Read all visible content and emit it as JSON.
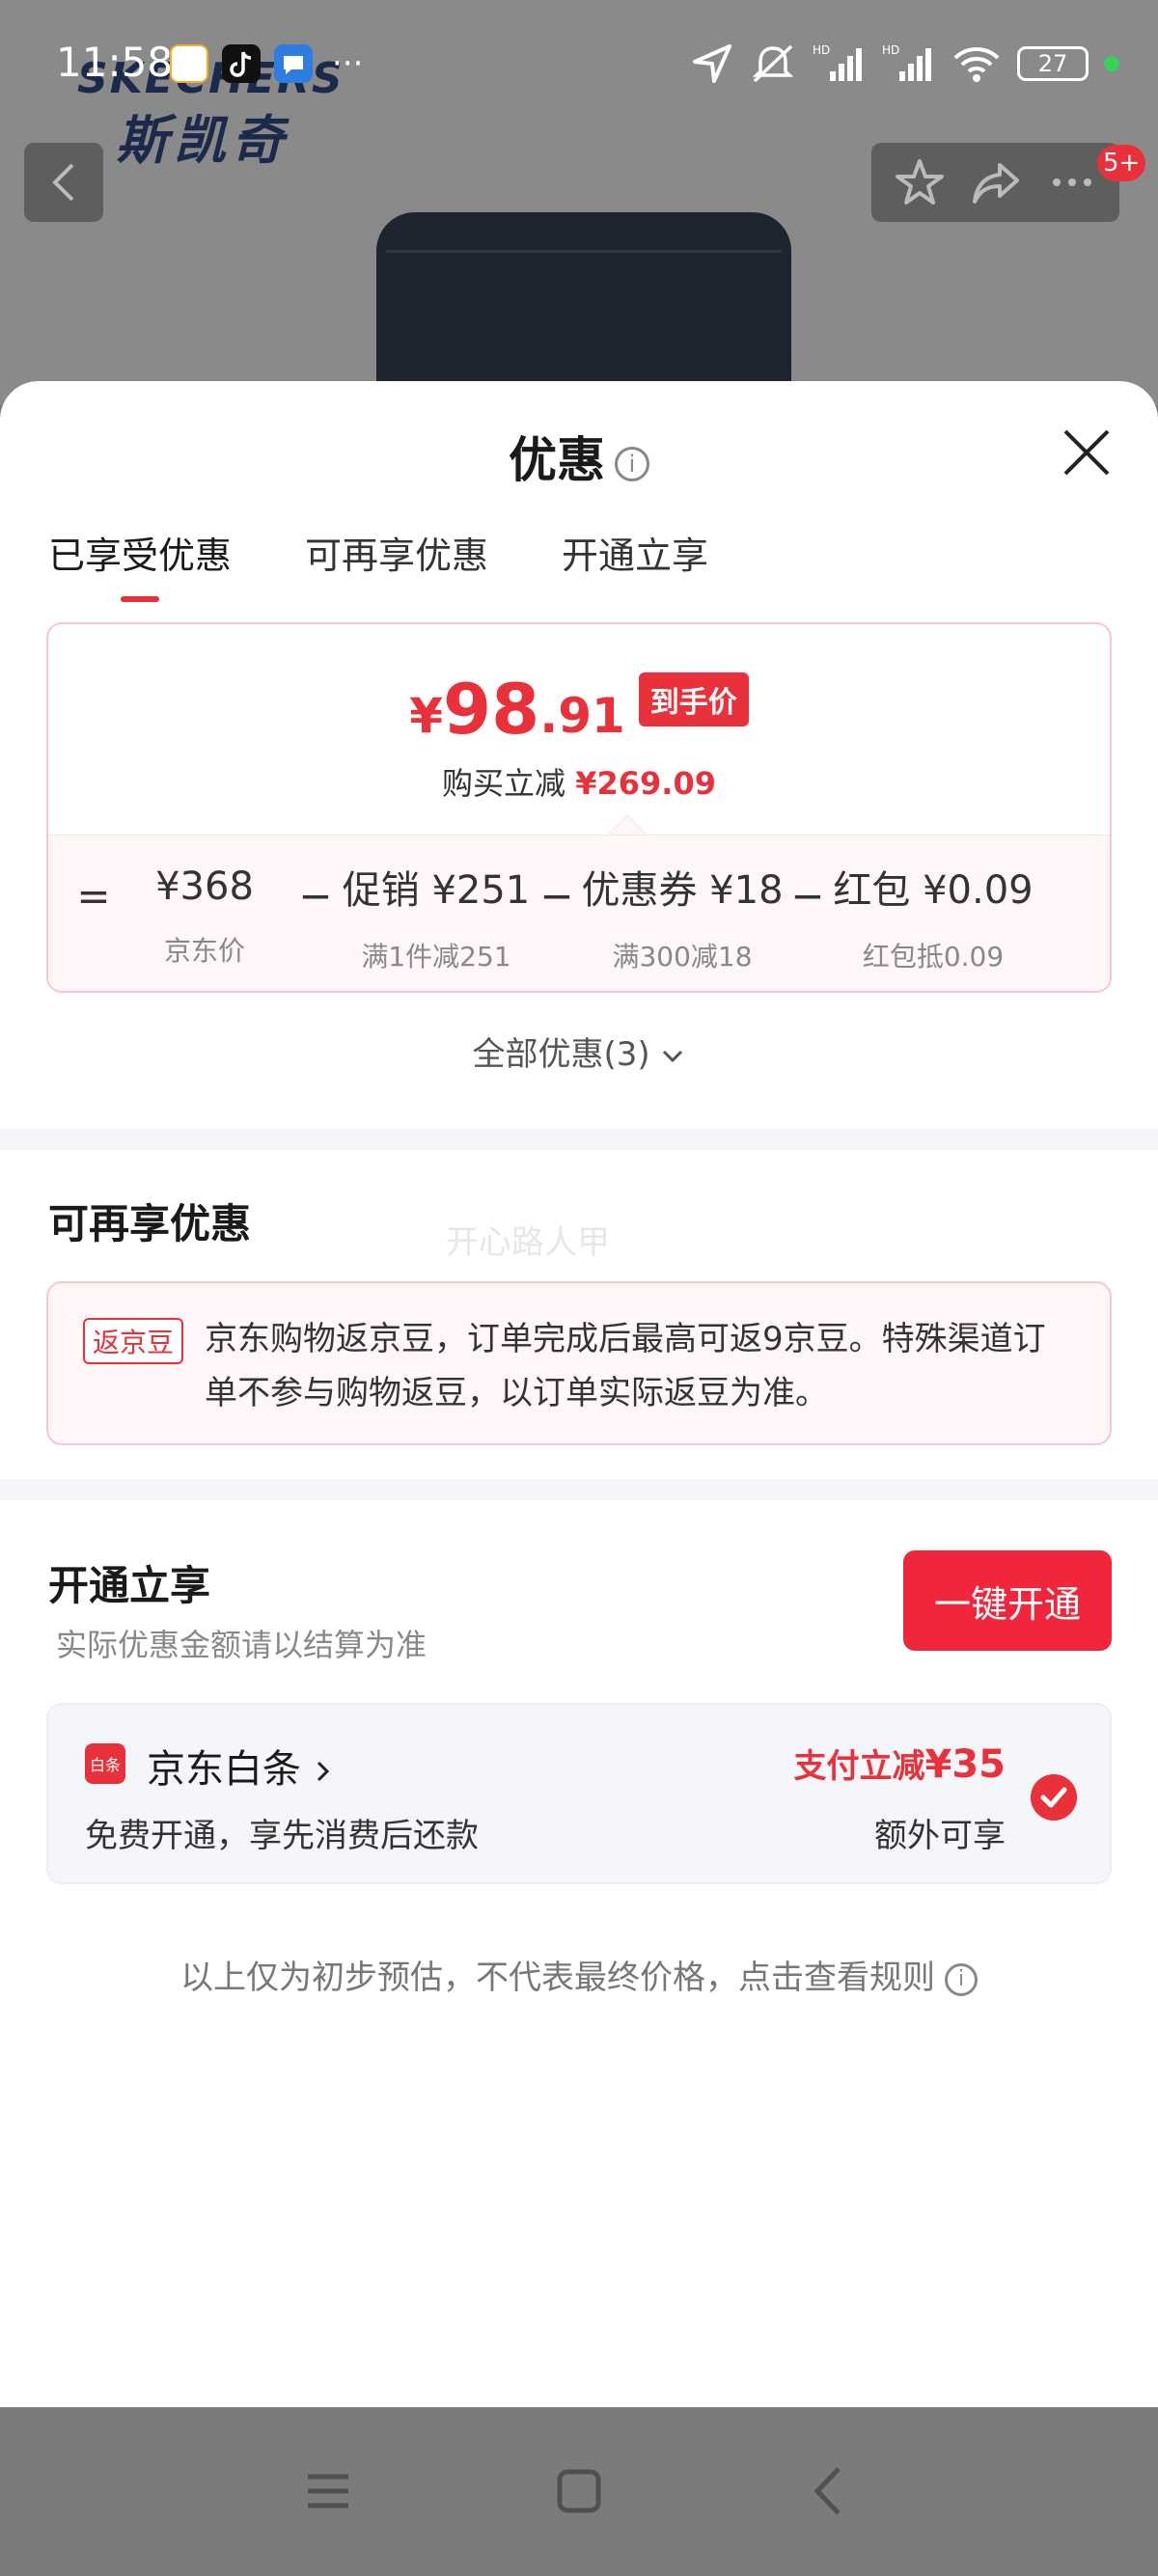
{
  "status_bar": {
    "time": "11:58",
    "more_apps": "···",
    "battery": "27"
  },
  "product_page": {
    "brand_en": "SKECHERS",
    "brand_cn": "斯凯奇",
    "cart_badge": "5+"
  },
  "sheet": {
    "title": "优惠",
    "tabs": [
      {
        "label": "已享受优惠",
        "active": true
      },
      {
        "label": "可再享优惠",
        "active": false
      },
      {
        "label": "开通立享",
        "active": false
      }
    ],
    "price": {
      "currency": "¥",
      "integer": "98",
      "decimal": ".91",
      "tag": "到手价",
      "saving_label": "购买立减",
      "saving_value": "¥269.09"
    },
    "breakdown": {
      "eq": "=",
      "minus": "−",
      "items": [
        {
          "value": "¥368",
          "label": "京东价"
        },
        {
          "value": "促销 ¥251",
          "label": "满1件减251"
        },
        {
          "value": "优惠券 ¥18",
          "label": "满300减18"
        },
        {
          "value": "红包 ¥0.09",
          "label": "红包抵0.09"
        }
      ]
    },
    "all_offers": "全部优惠(3)",
    "more_section": {
      "title": "可再享优惠",
      "watermark": "开心路人甲",
      "bean_tag": "返京豆",
      "bean_text": "京东购物返京豆，订单完成后最高可返9京豆。特殊渠道订单不参与购物返豆，以订单实际返豆为准。"
    },
    "open_section": {
      "title": "开通立享",
      "subtitle": "实际优惠金额请以结算为准",
      "button": "一键开通",
      "baitiao": {
        "icon_text": "白条",
        "name": "京东白条",
        "desc": "免费开通，享先消费后还款",
        "promo_label": "支付立减",
        "promo_amount": "¥35",
        "extra": "额外可享"
      }
    },
    "disclaimer": "以上仅为初步预估，不代表最终价格，点击查看规则"
  },
  "colors": {
    "accent": "#e8313a",
    "button": "#f0263c",
    "card_bg": "#fff6f7"
  }
}
